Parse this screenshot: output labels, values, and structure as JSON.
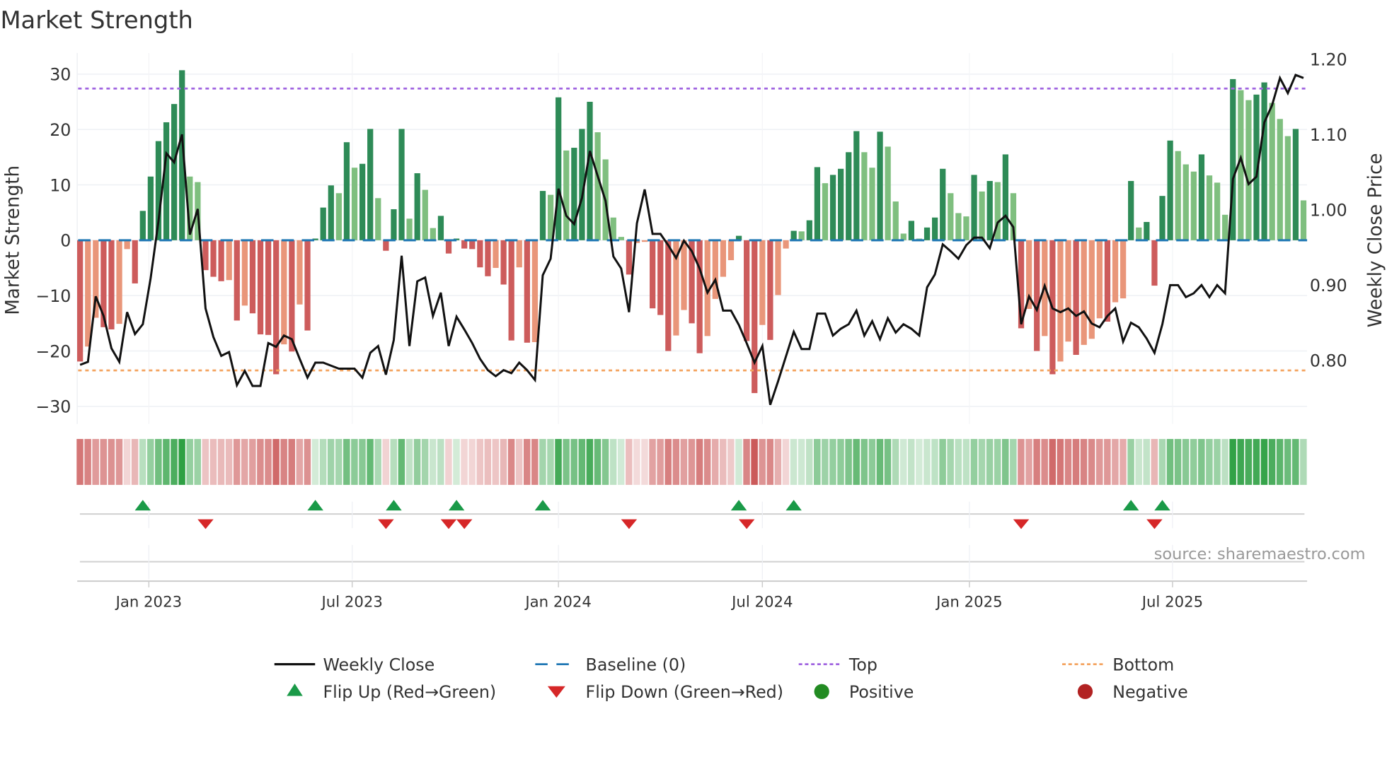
{
  "chart_data": {
    "type": "bar",
    "title": "Market Strength",
    "ylabel": "Market Strength",
    "y2label": "Weekly Close Price",
    "ylim": [
      -32,
      34
    ],
    "y2lim": [
      0.72,
      1.2435
    ],
    "yticks": [
      {
        "v": 30,
        "label": "30"
      },
      {
        "v": 20,
        "label": "20"
      },
      {
        "v": 10,
        "label": "10"
      },
      {
        "v": 0,
        "label": "0"
      },
      {
        "v": -10,
        "label": "−10"
      },
      {
        "v": -20,
        "label": "−20"
      },
      {
        "v": -30,
        "label": "−30"
      }
    ],
    "y2ticks": [
      {
        "v": 1.2,
        "label": "1.20"
      },
      {
        "v": 1.1,
        "label": "1.10"
      },
      {
        "v": 1.0,
        "label": "1.00"
      },
      {
        "v": 0.9,
        "label": "0.90"
      },
      {
        "v": 0.8,
        "label": "0.80"
      }
    ],
    "xticks": [
      {
        "week": 9.77,
        "label": "Jan 2023"
      },
      {
        "week": 35.7,
        "label": "Jul 2023"
      },
      {
        "week": 62.0,
        "label": "Jan 2024"
      },
      {
        "week": 88.0,
        "label": "Jul 2024"
      },
      {
        "week": 114.4,
        "label": "Jan 2025"
      },
      {
        "week": 140.3,
        "label": "Jul 2025"
      }
    ],
    "grid": true,
    "thresholds": {
      "top": 27.4,
      "bottom": -23.5,
      "baseline": 0
    },
    "strength": [
      -21.9,
      -19.2,
      -14,
      -15.7,
      -16.1,
      -15.1,
      -1.6,
      -7.8,
      5.3,
      11.5,
      17.9,
      21.3,
      24.6,
      30.7,
      11.5,
      10.5,
      -5.4,
      -6.6,
      -7.4,
      -7.2,
      -14.5,
      -11.8,
      -13.2,
      -17,
      -17.1,
      -24.2,
      -18.8,
      -20.1,
      -11.6,
      -16.3,
      0.3,
      5.9,
      9.9,
      8.5,
      17.7,
      13.1,
      13.8,
      20.1,
      7.6,
      -1.9,
      5.6,
      20.1,
      3.9,
      12.1,
      9.1,
      2.2,
      4.4,
      -2.4,
      0.3,
      -1.5,
      -1.6,
      -4.9,
      -6.5,
      -5,
      -8,
      -18.1,
      -4.9,
      -18.5,
      -18.4,
      8.9,
      8.2,
      25.8,
      16.2,
      16.7,
      20.1,
      25,
      19.5,
      14.6,
      4.1,
      0.6,
      -6.2,
      -0.5,
      -0.3,
      -12.3,
      -13.5,
      -20,
      -17.2,
      -12.6,
      -15,
      -20.4,
      -17.3,
      -10.6,
      -6.6,
      -3.6,
      0.8,
      -18.2,
      -27.6,
      -15.3,
      -18,
      -9.9,
      -1.5,
      1.7,
      1.6,
      3.6,
      13.2,
      10.3,
      11.8,
      12.9,
      15.9,
      19.7,
      15.9,
      13.1,
      19.6,
      16.9,
      7,
      1.2,
      3.5,
      0.3,
      2.3,
      4.1,
      12.9,
      8.5,
      4.9,
      4.3,
      11.8,
      8.8,
      10.7,
      10.5,
      15.5,
      8.5,
      -15.9,
      -12.4,
      -20,
      -17.3,
      -24.2,
      -21.9,
      -18.3,
      -20.7,
      -18.9,
      -17.8,
      -14.1,
      -14.7,
      -11.2,
      -10.5,
      10.7,
      2.3,
      3.3,
      -8.2,
      8,
      18,
      16.1,
      13.7,
      12.4,
      15.5,
      11.7,
      10.4,
      4.6,
      29.1,
      27.1,
      25.3,
      26.3,
      28.5,
      24.8,
      21.9,
      18.8,
      20.1,
      7.2
    ],
    "weekly_close": [
      0.794,
      0.798,
      0.885,
      0.859,
      0.816,
      0.798,
      0.864,
      0.835,
      0.848,
      0.909,
      0.985,
      1.075,
      1.063,
      1.1,
      0.967,
      1.001,
      0.869,
      0.831,
      0.806,
      0.811,
      0.767,
      0.786,
      0.766,
      0.766,
      0.823,
      0.818,
      0.833,
      0.828,
      0.802,
      0.777,
      0.797,
      0.797,
      0.793,
      0.789,
      0.789,
      0.789,
      0.777,
      0.81,
      0.819,
      0.781,
      0.827,
      0.939,
      0.819,
      0.905,
      0.91,
      0.859,
      0.89,
      0.819,
      0.858,
      0.841,
      0.823,
      0.802,
      0.787,
      0.779,
      0.787,
      0.783,
      0.797,
      0.787,
      0.774,
      0.913,
      0.935,
      1.028,
      0.992,
      0.981,
      1.016,
      1.078,
      1.045,
      1.012,
      0.938,
      0.922,
      0.864,
      0.982,
      1.027,
      0.968,
      0.968,
      0.953,
      0.936,
      0.959,
      0.945,
      0.922,
      0.89,
      0.907,
      0.866,
      0.866,
      0.847,
      0.823,
      0.797,
      0.819,
      0.741,
      0.772,
      0.805,
      0.838,
      0.815,
      0.815,
      0.862,
      0.862,
      0.833,
      0.842,
      0.848,
      0.866,
      0.833,
      0.852,
      0.828,
      0.856,
      0.837,
      0.848,
      0.842,
      0.833,
      0.897,
      0.914,
      0.954,
      0.945,
      0.935,
      0.953,
      0.963,
      0.963,
      0.949,
      0.983,
      0.992,
      0.977,
      0.848,
      0.885,
      0.867,
      0.899,
      0.869,
      0.864,
      0.869,
      0.859,
      0.865,
      0.849,
      0.844,
      0.859,
      0.869,
      0.825,
      0.85,
      0.844,
      0.829,
      0.81,
      0.848,
      0.9,
      0.9,
      0.884,
      0.889,
      0.9,
      0.884,
      0.9,
      0.889,
      1.041,
      1.069,
      1.034,
      1.044,
      1.116,
      1.139,
      1.175,
      1.155,
      1.179,
      1.175
    ],
    "flip_up_weeks": [
      9,
      31,
      41,
      49,
      60,
      85,
      92,
      135,
      139
    ],
    "flip_down_weeks": [
      17,
      40,
      48,
      50,
      71,
      86,
      121,
      138
    ],
    "legend": {
      "placement": "bottom",
      "items": [
        {
          "key": "close",
          "label": "Weekly Close"
        },
        {
          "key": "baseline",
          "label": "Baseline (0)"
        },
        {
          "key": "top",
          "label": "Top"
        },
        {
          "key": "bottom",
          "label": "Bottom"
        },
        {
          "key": "flipup",
          "label": "Flip Up (Red→Green)"
        },
        {
          "key": "flipdown",
          "label": "Flip Down (Green→Red)"
        },
        {
          "key": "positive",
          "label": "Positive"
        },
        {
          "key": "negative",
          "label": "Negative"
        }
      ]
    },
    "annotation": "source: sharemaestro.com",
    "colors": {
      "pos_strong": "#2e8b57",
      "pos_weak": "#7fbf7f",
      "neg_strong": "#cd5c5c",
      "neg_weak": "#e9967a",
      "close": "#111111",
      "baseline": "#1f77b4",
      "top": "#a064e0",
      "bottom": "#f4a460",
      "flip_up": "#1a9a48",
      "flip_down": "#d62728",
      "positive": "#228b22",
      "negative": "#b22222"
    }
  }
}
